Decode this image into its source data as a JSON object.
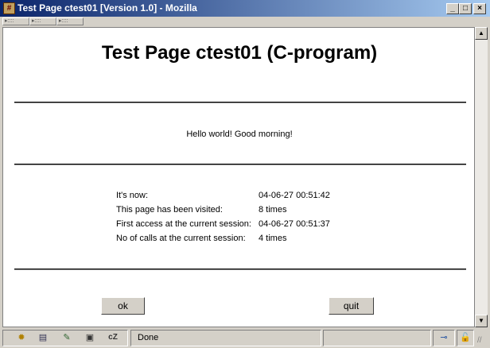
{
  "window": {
    "title": "Test Page ctest01 [Version 1.0] - Mozilla"
  },
  "page": {
    "heading": "Test Page ctest01 (C-program)",
    "greeting": "Hello world! Good morning!",
    "info": [
      {
        "label": "It's now:",
        "value": "04-06-27 00:51:42"
      },
      {
        "label": "This page has been visited:",
        "value": "8 times"
      },
      {
        "label": "First access at the current session:",
        "value": "04-06-27 00:51:37"
      },
      {
        "label": "No of calls at the current session:",
        "value": "4 times"
      }
    ],
    "ok_label": "ok",
    "quit_label": "quit"
  },
  "status": {
    "text": "Done"
  }
}
